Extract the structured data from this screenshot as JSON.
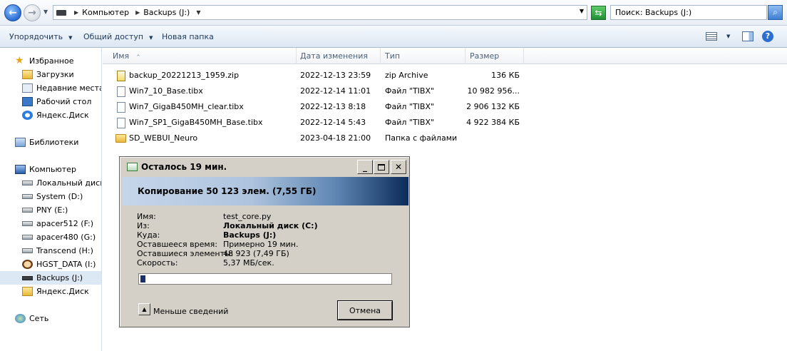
{
  "address": {
    "root": "Компьютер",
    "drive": "Backups (J:)"
  },
  "search": {
    "placeholder": "Поиск: Backups (J:)"
  },
  "toolbar": {
    "organize": "Упорядочить",
    "share": "Общий доступ",
    "new_folder": "Новая папка"
  },
  "sidebar": {
    "favorites": {
      "label": "Избранное",
      "items": [
        "Загрузки",
        "Недавние места",
        "Рабочий стол",
        "Яндекс.Диск"
      ]
    },
    "libraries": "Библиотеки",
    "computer": {
      "label": "Компьютер",
      "items": [
        "Локальный диск (",
        "System (D:)",
        "PNY (E:)",
        "apacer512 (F:)",
        "apacer480 (G:)",
        "Transcend (H:)",
        "HGST_DATA (I:)",
        "Backups (J:)",
        "Яндекс.Диск"
      ]
    },
    "network": "Сеть",
    "selected": "Backups (J:)"
  },
  "columns": {
    "name": "Имя",
    "date": "Дата изменения",
    "type": "Тип",
    "size": "Размер"
  },
  "files": [
    {
      "name": "backup_20221213_1959.zip",
      "date": "2022-12-13 23:59",
      "type": "zip Archive",
      "size": "136 КБ",
      "kind": "zip"
    },
    {
      "name": "Win7_10_Base.tibx",
      "date": "2022-12-14 11:01",
      "type": "Файл \"TIBX\"",
      "size": "10 982 956...",
      "kind": "file"
    },
    {
      "name": "Win7_GigaB450MH_clear.tibx",
      "date": "2022-12-13 8:18",
      "type": "Файл \"TIBX\"",
      "size": "2 906 132 КБ",
      "kind": "file"
    },
    {
      "name": "Win7_SP1_GigaB450MH_Base.tibx",
      "date": "2022-12-14 5:43",
      "type": "Файл \"TIBX\"",
      "size": "4 922 384 КБ",
      "kind": "file"
    },
    {
      "name": "SD_WEBUI_Neuro",
      "date": "2023-04-18 21:00",
      "type": "Папка с файлами",
      "size": "",
      "kind": "folder"
    }
  ],
  "dialog": {
    "title": "Осталось 19 мин.",
    "heading": "Копирование 50 123 элем. (7,55 ГБ)",
    "labels": {
      "name": "Имя:",
      "from": "Из:",
      "to": "Куда:",
      "time_left": "Оставшееся время:",
      "items_left": "Оставшиеся элементы:",
      "speed": "Скорость:"
    },
    "values": {
      "name": "test_core.py",
      "from": "Локальный диск (C:)",
      "to": "Backups (J:)",
      "time_left": "Примерно 19 мин.",
      "items_left": "48 923 (7,49 ГБ)",
      "speed": "5,37 МБ/сек."
    },
    "progress": 0.02,
    "less_details": "Меньше сведений",
    "cancel": "Отмена"
  }
}
